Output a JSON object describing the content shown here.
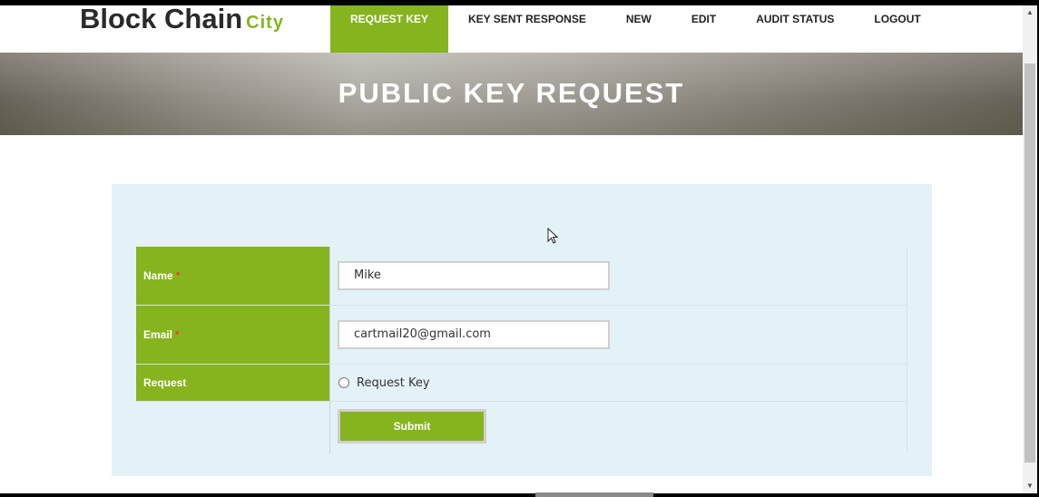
{
  "brand": {
    "main": "Block Chain",
    "accent": "City"
  },
  "nav": {
    "items": [
      {
        "label": "REQUEST KEY",
        "active": true
      },
      {
        "label": "KEY SENT RESPONSE"
      },
      {
        "label": "NEW"
      },
      {
        "label": "EDIT"
      },
      {
        "label": "AUDIT STATUS"
      },
      {
        "label": "LOGOUT"
      }
    ]
  },
  "banner": {
    "title": "PUBLIC KEY REQUEST"
  },
  "form": {
    "name": {
      "label": "Name",
      "required_mark": "*",
      "value": "Mike"
    },
    "email": {
      "label": "Email",
      "required_mark": "*",
      "value": "cartmail20@gmail.com"
    },
    "request": {
      "label": "Request",
      "option_label": "Request Key",
      "selected": false
    },
    "submit_label": "Submit"
  },
  "colors": {
    "accent": "#86b41e",
    "panel_bg": "#e4f1f7",
    "required": "#ff3b1f"
  },
  "icons": {
    "cursor": "mouse-pointer-icon",
    "scroll_up": "scroll-up-arrow-icon",
    "scroll_down": "scroll-down-arrow-icon"
  }
}
